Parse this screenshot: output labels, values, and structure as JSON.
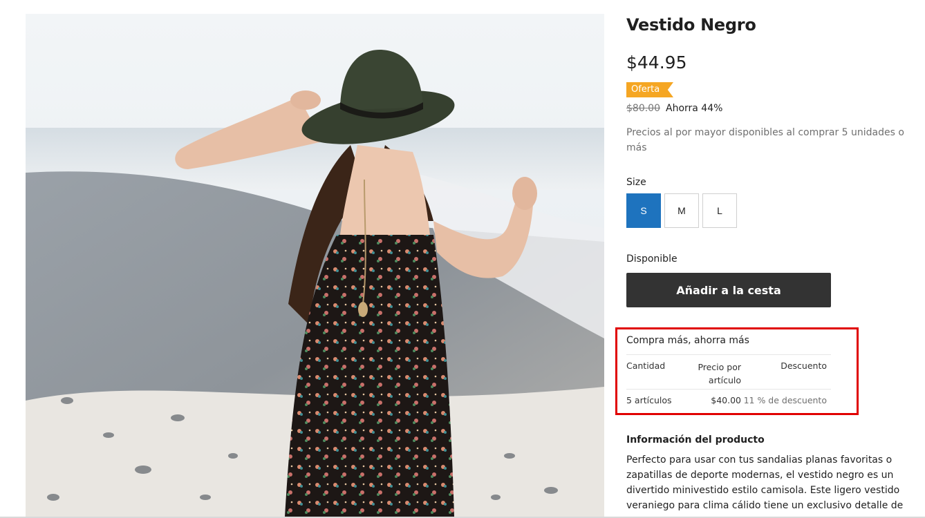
{
  "product": {
    "title": "Vestido Negro",
    "price": "$44.95",
    "sale_badge": "Oferta",
    "compare_price": "$80.00",
    "savings": "Ahorra 44%",
    "wholesale_note": "Precios al por mayor disponibles al comprar 5 unidades o más",
    "image_alt": "Mujer con sombrero y vestido negro floral en la playa"
  },
  "size_selector": {
    "label": "Size",
    "options": [
      "S",
      "M",
      "L"
    ],
    "selected": "S"
  },
  "availability": "Disponible",
  "add_to_cart_label": "Añadir a la cesta",
  "volume_discount": {
    "title": "Compra más, ahorra más",
    "headers": [
      "Cantidad",
      "Precio por artículo",
      "Descuento"
    ],
    "rows": [
      {
        "quantity": "5 artículos",
        "price": "$40.00",
        "discount": "11 % de descuento"
      }
    ]
  },
  "product_info": {
    "title": "Información del producto",
    "description": "Perfecto para usar con tus sandalias planas favoritas o zapatillas de deporte modernas, el vestido negro es un divertido minivestido estilo camisola. Este ligero vestido veraniego para clima cálido tiene un exclusivo detalle de"
  },
  "colors": {
    "accent": "#1e73be",
    "badge": "#f5a623",
    "button": "#333333",
    "highlight_border": "#e00000"
  }
}
